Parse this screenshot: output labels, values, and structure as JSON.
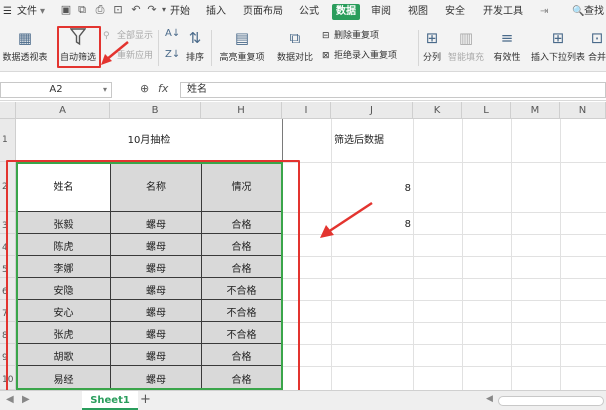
{
  "menu": {
    "file": "文件",
    "items": [
      "开始",
      "插入",
      "页面布局",
      "公式",
      "数据",
      "审阅",
      "视图",
      "安全",
      "开发工具"
    ],
    "active": "数据",
    "search": "查找"
  },
  "ribbon": {
    "pivot": "数据透视表",
    "autofilter": "自动筛选",
    "show_all": "全部显示",
    "reapply": "重新应用",
    "sort": "排序",
    "highlight_dup": "高亮重复项",
    "compare": "数据对比",
    "delete_dup": "删除重复项",
    "reject_dup": "拒绝录入重复项",
    "split": "分列",
    "smart_fill": "智能填充",
    "validity": "有效性",
    "insert_dropdown": "插入下拉列表",
    "merge": "合并"
  },
  "formula_bar": {
    "cell_ref": "A2",
    "fx": "fx",
    "content": "姓名"
  },
  "columns": [
    "A",
    "B",
    "H",
    "I",
    "J",
    "K",
    "L",
    "M",
    "N"
  ],
  "rows": [
    "1",
    "2",
    "3",
    "4",
    "5",
    "6",
    "7",
    "8",
    "9",
    "10"
  ],
  "sheet": {
    "title": "10月抽检",
    "headers": [
      "姓名",
      "名称",
      "情况"
    ],
    "records": [
      [
        "张毅",
        "螺母",
        "合格"
      ],
      [
        "陈虎",
        "螺母",
        "合格"
      ],
      [
        "李娜",
        "螺母",
        "合格"
      ],
      [
        "安隐",
        "螺母",
        "不合格"
      ],
      [
        "安心",
        "螺母",
        "不合格"
      ],
      [
        "张虎",
        "螺母",
        "不合格"
      ],
      [
        "胡歌",
        "螺母",
        "合格"
      ],
      [
        "易经",
        "螺母",
        "合格"
      ]
    ],
    "side_label": "筛选后数据",
    "values": [
      "8",
      "8"
    ]
  },
  "tabs": {
    "sheet1": "Sheet1",
    "add": "+"
  },
  "colors": {
    "accent": "#2a9d5c",
    "annotation": "#e3342f",
    "selection": "#3aa54a",
    "table_fill": "#d9d9d9"
  }
}
